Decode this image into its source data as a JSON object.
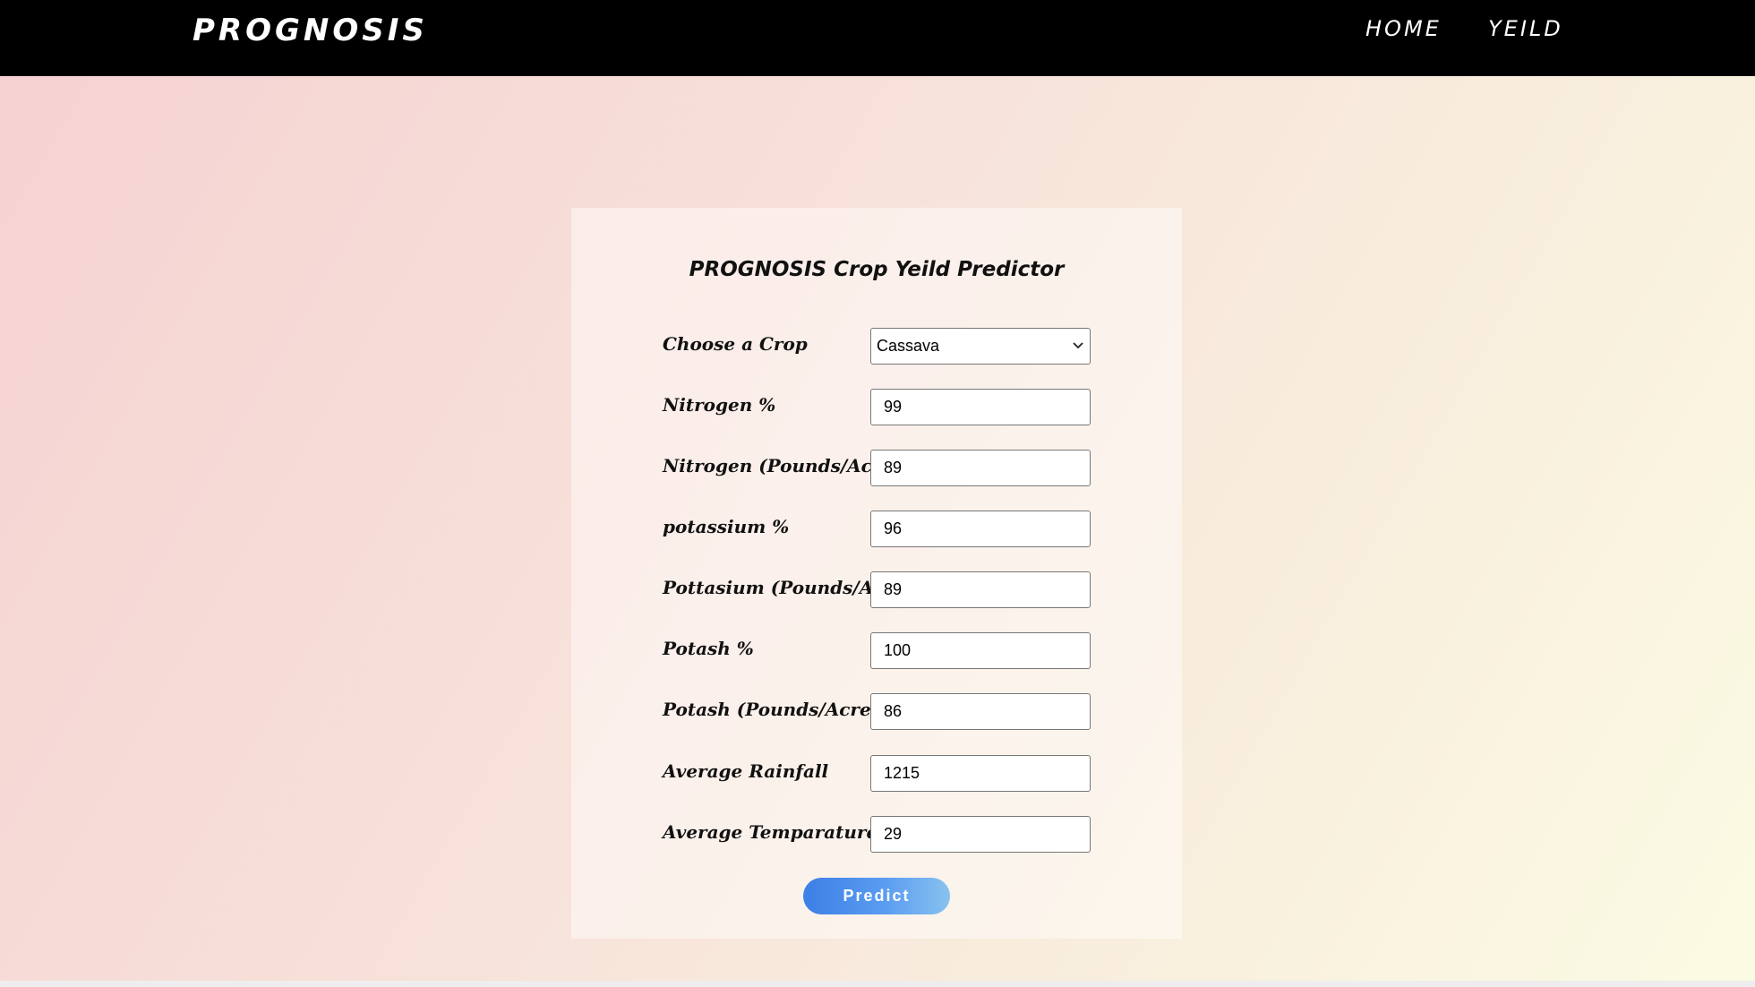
{
  "navbar": {
    "brand": "PROGNOSIS",
    "links": [
      "HOME",
      "YEILD"
    ]
  },
  "form": {
    "title": "PROGNOSIS Crop Yeild Predictor",
    "crop": {
      "label": "Choose a Crop",
      "value": "Cassava"
    },
    "fields": [
      {
        "label": "Nitrogen %",
        "value": "99"
      },
      {
        "label": "Nitrogen (Pounds/Acre)",
        "value": "89"
      },
      {
        "label": "potassium %",
        "value": "96"
      },
      {
        "label": "Pottasium (Pounds/Acre)",
        "value": "89"
      },
      {
        "label": "Potash %",
        "value": "100"
      },
      {
        "label": "Potash (Pounds/Acre)",
        "value": "86"
      },
      {
        "label": "Average Rainfall",
        "value": "1215"
      },
      {
        "label": "Average Temparature",
        "value": "29"
      }
    ],
    "submit_label": "Predict"
  },
  "colors": {
    "navbar": "#000000",
    "button_start": "#3c7fe6",
    "button_end": "#88c2ef",
    "background_pink": "#f6d2d2",
    "background_cream": "#fbfbe3"
  }
}
